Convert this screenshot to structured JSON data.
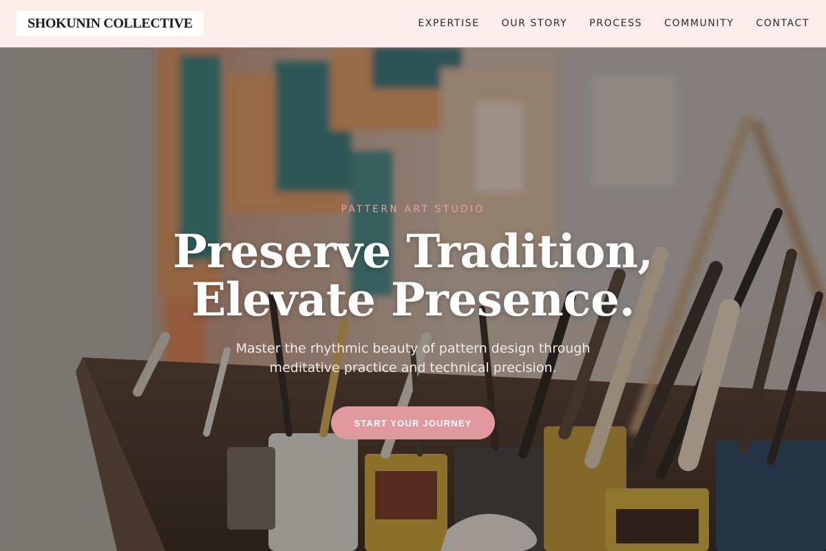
{
  "brand": {
    "name": "SHOKUNIN COLLECTIVE"
  },
  "nav": {
    "items": [
      {
        "label": "EXPERTISE"
      },
      {
        "label": "OUR STORY"
      },
      {
        "label": "PROCESS"
      },
      {
        "label": "COMMUNITY"
      },
      {
        "label": "CONTACT"
      }
    ]
  },
  "hero": {
    "eyebrow": "PATTERN ART STUDIO",
    "headline_line1": "Preserve Tradition,",
    "headline_line2": "Elevate Presence.",
    "subtext": "Master the rhythmic beauty of pattern design through meditative practice and technical precision.",
    "cta_label": "START YOUR JOURNEY",
    "image": "art-studio-paint-brushes-photo"
  },
  "colors": {
    "nav_bg": "#fdeeee",
    "accent": "#e2989f",
    "eyebrow": "#e8a0a8",
    "headline": "#ffffff"
  }
}
